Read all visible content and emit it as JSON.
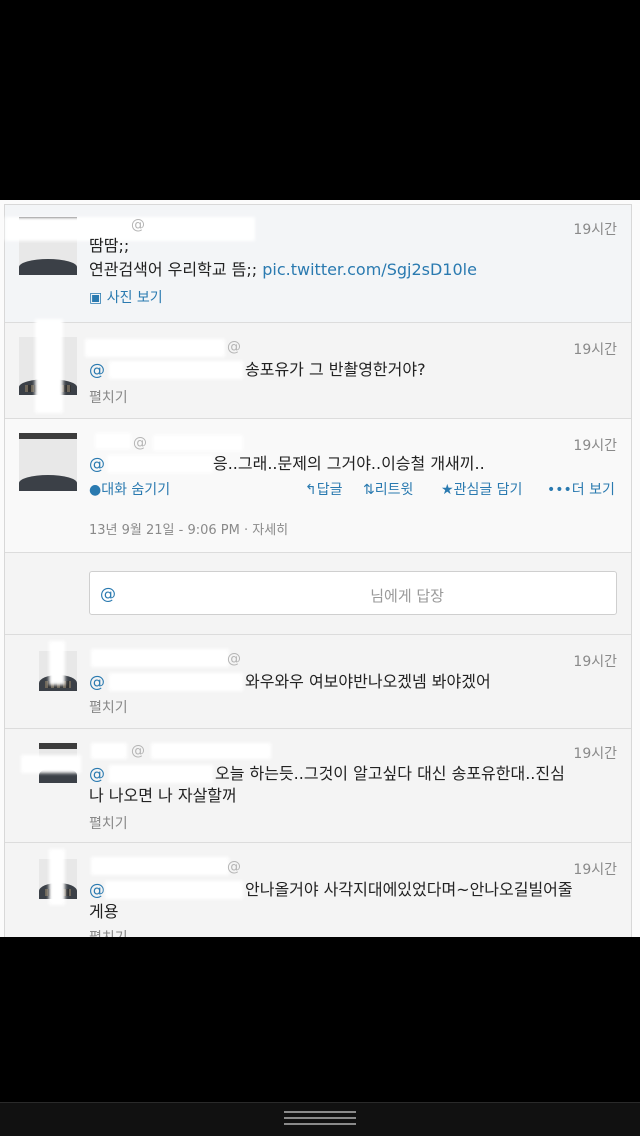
{
  "tweets": [
    {
      "time": "19시간",
      "at": "@",
      "line1": "땀땀;;",
      "line2_text": "연관검색어 우리학교 뜸;; ",
      "line2_link": "pic.twitter.com/Sgj2sD10le",
      "action": "사진 보기",
      "action_icon": "photo-icon"
    },
    {
      "time": "19시간",
      "at": "@",
      "mention": "@",
      "text": "송포유가 그 반촬영한거야?",
      "action": "펼치기"
    },
    {
      "time": "19시간",
      "at": "@",
      "mention": "@",
      "text": "응..그래..문제의 그거야..이승철 개새끼..",
      "actions": {
        "hide_conversation": "대화 숨기기",
        "reply": "답글",
        "retweet": "리트윗",
        "favorite": "관심글 담기",
        "more": "더 보기"
      },
      "meta": "13년 9월 21일 - 9:06 PM · 자세히"
    }
  ],
  "reply_box": {
    "at": "@",
    "placeholder": "님에게 답장"
  },
  "replies": [
    {
      "time": "19시간",
      "at": "@",
      "mention": "@",
      "text": "와우와우 여보야반나오겠넴 봐야겠어",
      "action": "펼치기"
    },
    {
      "time": "19시간",
      "at": "@",
      "mention": "@",
      "text_line1": "오늘 하는듯..그것이 알고싶다 대신 송포유한대..진심",
      "text_line2": "나 나오면 나 자살할꺼",
      "action": "펼치기"
    },
    {
      "time": "19시간",
      "at": "@",
      "mention": "@",
      "text_line1": "안나올거야 사각지대에있었다며~안나오길빌어줄",
      "text_line2": "게용",
      "action": "펼치기"
    }
  ],
  "colors": {
    "accent": "#2a7ab0",
    "muted": "#8a8a8a"
  },
  "system_nav": {
    "icon": "menu-icon"
  }
}
